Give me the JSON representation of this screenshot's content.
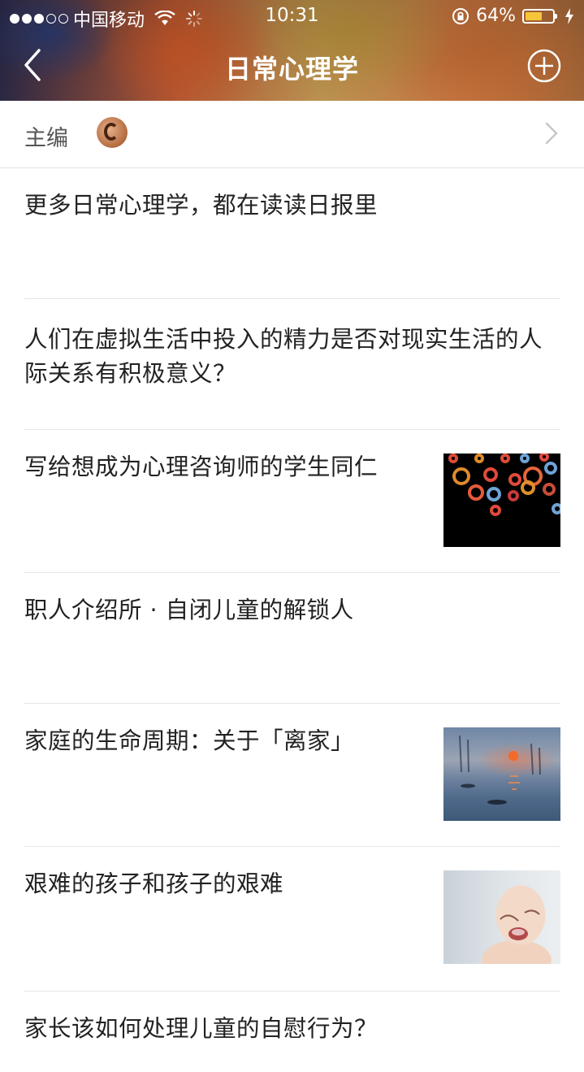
{
  "status_bar": {
    "carrier": "中国移动",
    "time": "10:31",
    "battery_percent": "64%",
    "battery_level": 0.64,
    "signal_bars_on": 3,
    "signal_bars_total": 5
  },
  "nav": {
    "title": "日常心理学",
    "back_icon": "chevron-left-icon",
    "add_icon": "plus-circle-icon"
  },
  "editor": {
    "label": "主编"
  },
  "articles": [
    {
      "title": "更多日常心理学，都在读读日报里",
      "thumbnail": null
    },
    {
      "title": "人们在虚拟生活中投入的精力是否对现实生活的人际关系有积极意义？",
      "thumbnail": null
    },
    {
      "title": "写给想成为心理咨询师的学生同仁",
      "thumbnail": "gears"
    },
    {
      "title": "职人介绍所 · 自闭儿童的解锁人",
      "thumbnail": null
    },
    {
      "title": "家庭的生命周期：关于「离家」",
      "thumbnail": "sunrise-painting"
    },
    {
      "title": "艰难的孩子和孩子的艰难",
      "thumbnail": "crying-baby"
    },
    {
      "title": "家长该如何处理儿童的自慰行为？",
      "thumbnail": null
    }
  ],
  "colors": {
    "battery_fill": "#f5c63a",
    "divider": "#e6e6e6",
    "text": "#222222"
  }
}
